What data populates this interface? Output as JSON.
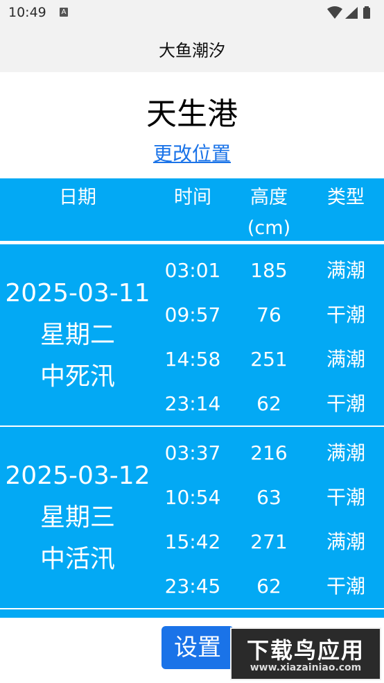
{
  "status_bar": {
    "time": "10:49",
    "notification_badge": "A"
  },
  "app_bar": {
    "title": "大鱼潮汐"
  },
  "location": {
    "port": "天生港",
    "change_link": "更改位置"
  },
  "table_header": {
    "date": "日期",
    "time": "时间",
    "height": "高度\n(cm)",
    "type": "类型"
  },
  "days": [
    {
      "date": "2025-03-11",
      "weekday": "星期二",
      "tide_phase": "中死汛",
      "tides": [
        {
          "time": "03:01",
          "height": "185",
          "type": "满潮"
        },
        {
          "time": "09:57",
          "height": "76",
          "type": "干潮"
        },
        {
          "time": "14:58",
          "height": "251",
          "type": "满潮"
        },
        {
          "time": "23:14",
          "height": "62",
          "type": "干潮"
        }
      ]
    },
    {
      "date": "2025-03-12",
      "weekday": "星期三",
      "tide_phase": "中活汛",
      "tides": [
        {
          "time": "03:37",
          "height": "216",
          "type": "满潮"
        },
        {
          "time": "10:54",
          "height": "63",
          "type": "干潮"
        },
        {
          "time": "15:42",
          "height": "271",
          "type": "满潮"
        },
        {
          "time": "23:45",
          "height": "62",
          "type": "干潮"
        }
      ]
    }
  ],
  "settings_button": "设置",
  "watermark": {
    "main": "下载鸟应用",
    "sub": "www.xiazainiao.com"
  },
  "colors": {
    "accent": "#03a9f4",
    "button": "#1a73e8",
    "link": "#1a73e8"
  }
}
